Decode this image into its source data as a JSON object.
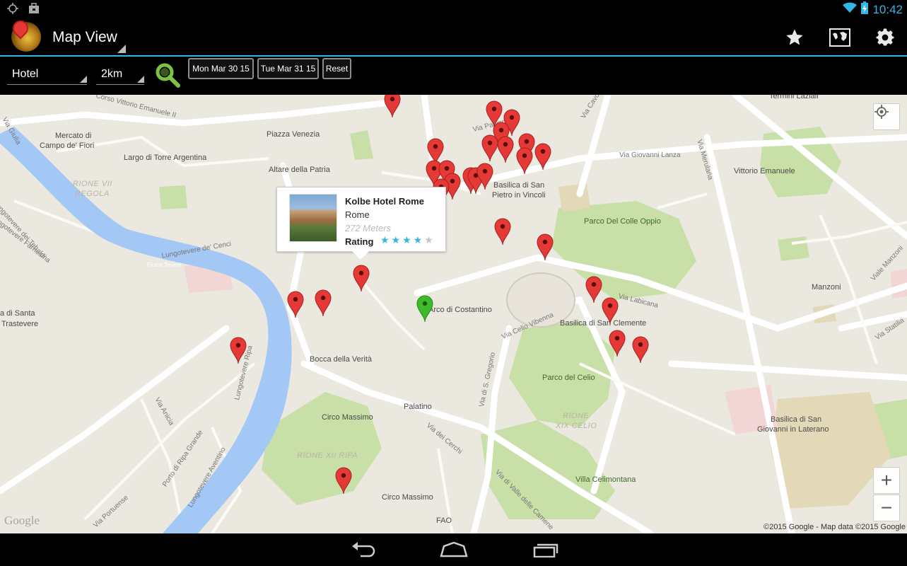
{
  "status_bar": {
    "time": "10:42"
  },
  "action_bar": {
    "title": "Map View",
    "actions": [
      {
        "name": "favorites",
        "icon": "star-icon"
      },
      {
        "name": "map-type",
        "icon": "world-map-icon"
      },
      {
        "name": "settings",
        "icon": "gear-icon"
      }
    ]
  },
  "toolbar": {
    "category_value": "Hotel",
    "radius_value": "2km",
    "checkin_label": "Mon Mar 30 15",
    "checkout_label": "Tue Mar 31 15",
    "reset_label": "Reset"
  },
  "map": {
    "labels": {
      "corso": "Corso Vittorio Emanuele II",
      "piazza_venezia": "Piazza Venezia",
      "mercato1": "Mercato di",
      "mercato2": "Campo de' Fiori",
      "largo": "Largo di Torre Argentina",
      "altare": "Altare della Patria",
      "rione7a": "RIONE VII",
      "rione7b": "REGOLA",
      "lungo_tebaldi": "Lungotevere dei Tebaldi",
      "lungo_farnesina": "Lungotevere Farnesina",
      "via_giulia": "Via Giulia",
      "lungo_cenci": "Lungotevere de' Cenci",
      "fiume": "Fiume Tevere",
      "santa1": "a di Santa",
      "santa2": "Trastevere",
      "bocca": "Bocca della Verità",
      "arco": "Arco di Costantino",
      "basilica_pietro1": "Basilica di San",
      "basilica_pietro2": "Pietro in Vincoli",
      "parco_colle": "Parco Del Colle Oppio",
      "via_cavour": "Via Cavour",
      "via_lanza": "Via Giovanni Lanza",
      "via_merulana": "Via Merulana",
      "vittorio": "Vittorio Emanuele",
      "manzoni": "Manzoni",
      "via_labicana": "Via Labicana",
      "basilica_clemente": "Basilica di San Clemente",
      "via_celio": "Via Celio Vibenna",
      "parco_celio": "Parco del Celio",
      "rione19a": "RIONE",
      "rione19b": "XIX CELIO",
      "via_gregorio": "Via di S. Gregorio",
      "palatino": "Palatino",
      "circo1": "Circo Massimo",
      "via_cerchi": "Via dei Cerchi",
      "rione12": "RIONE XII RIPA",
      "circo2": "Circo Massimo",
      "fao": "FAO",
      "villa": "Villa Celimontana",
      "via_valle": "Via di Valle delle Camene",
      "laterano1": "Basilica di San",
      "laterano2": "Giovanni in Laterano",
      "via_anicia": "Via Anicia",
      "lungo_ripa": "Lungotevere Ripa",
      "porto": "Porto di Ripa Grande",
      "lungo_aventino": "Lungotevere Aventino",
      "via_portuense": "Via Portuense",
      "viale_manzoni": "Viale Manzoni",
      "via_statilia": "Via Statilia",
      "termini": "Termini Laziali",
      "via_panisperna": "Via Panisperna"
    },
    "info_window": {
      "name": "Kolbe Hotel Rome",
      "city": "Rome",
      "distance": "272 Meters",
      "rating_label": "Rating",
      "stars_filled": "★★★★",
      "stars_empty": "★",
      "rating": 4,
      "rating_max": 5
    },
    "google_logo": "Google",
    "attribution": "©2015 Google - Map data ©2015 Google",
    "zoom_in": "+",
    "zoom_out": "−",
    "colors": {
      "marker": "#e53935",
      "current_location": "#3fba2a",
      "water": "#a3c8f5",
      "park": "#c9dfa8",
      "accent": "#33b5e5"
    }
  }
}
